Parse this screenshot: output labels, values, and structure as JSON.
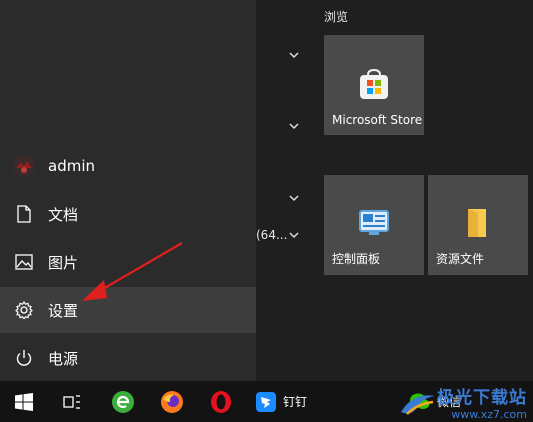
{
  "start_menu": {
    "user": {
      "name": "admin",
      "icon": "avatar-icon"
    },
    "rail": [
      {
        "label": "文档",
        "icon": "document-icon"
      },
      {
        "label": "图片",
        "icon": "pictures-icon"
      },
      {
        "label": "设置",
        "icon": "gear-icon",
        "active": true
      },
      {
        "label": "电源",
        "icon": "power-icon"
      }
    ],
    "list_partial_text": "(64...",
    "tile_group_header": "浏览",
    "tiles": [
      {
        "label": "Microsoft Store",
        "icon": "store-icon"
      },
      {
        "label": "控制面板",
        "icon": "control-panel-icon"
      },
      {
        "label": "资源文件",
        "icon": "folder-icon"
      }
    ]
  },
  "taskbar": {
    "items": [
      {
        "icon": "windows-start-icon"
      },
      {
        "icon": "task-view-icon"
      },
      {
        "icon": "browser-green-e-icon"
      },
      {
        "icon": "firefox-icon"
      },
      {
        "icon": "opera-icon"
      },
      {
        "icon": "dingtalk-icon",
        "label": "钉钉"
      },
      {
        "icon": "wechat-icon",
        "label": "微信"
      }
    ]
  },
  "watermark": {
    "title": "极光下载站",
    "url": "www.xz7.com"
  },
  "colors": {
    "accent_arrow": "#e0201c",
    "active_item": "#3d3d3d",
    "tile": "#4a4a4a"
  }
}
